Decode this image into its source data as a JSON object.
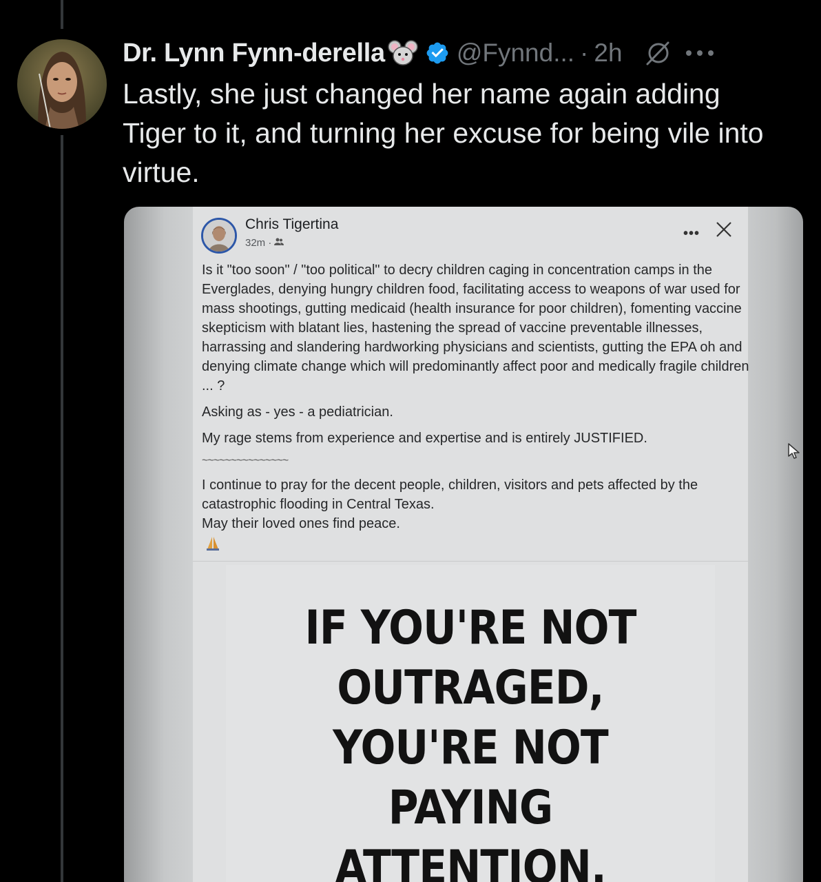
{
  "tweet": {
    "author_name": "Dr. Lynn Fynn-derella",
    "handle": "@Fynnd...",
    "separator": "·",
    "time": "2h",
    "text": "Lastly, she just changed her name again adding Tiger to it, and turning her excuse for being vile into virtue."
  },
  "embedded_post": {
    "author": "Chris Tigertina",
    "time": "32m ·",
    "paragraphs": [
      "Is it \"too soon\" / \"too political\" to decry children caging in concentration camps in the Everglades, denying hungry children food, facilitating access to weapons of war used for mass shootings, gutting medicaid (health insurance for poor children), fomenting vaccine skepticism with blatant lies, hastening the spread of vaccine preventable illnesses, harrassing and slandering hardworking physicians and scientists, gutting the EPA oh and denying climate change which will predominantly affect poor and medically fragile children ... ?",
      "Asking as - yes - a pediatrician.",
      "My rage stems from experience and expertise and is entirely JUSTIFIED."
    ],
    "divider": "~~~~~~~~~~~~~~~",
    "closing": "I continue to pray for the decent people, children, visitors and pets affected by the catastrophic flooding in Central Texas.\nMay their loved ones find peace.",
    "sign_lines": [
      "IF YOU'RE NOT",
      "OUTRAGED,",
      "YOU'RE NOT",
      "PAYING",
      "ATTENTION."
    ]
  },
  "icons": {
    "verified": "verified-badge-icon",
    "grok": "grok-icon",
    "more": "more-options-icon",
    "mouse": "mouse-face-emoji",
    "close": "close-icon",
    "praying_hands": "praying-hands-emoji",
    "cursor": "mouse-pointer-icon"
  },
  "colors": {
    "background": "#000000",
    "text_primary": "#e7e9ea",
    "text_secondary": "#71767b",
    "verified_blue": "#1d9bf0"
  }
}
